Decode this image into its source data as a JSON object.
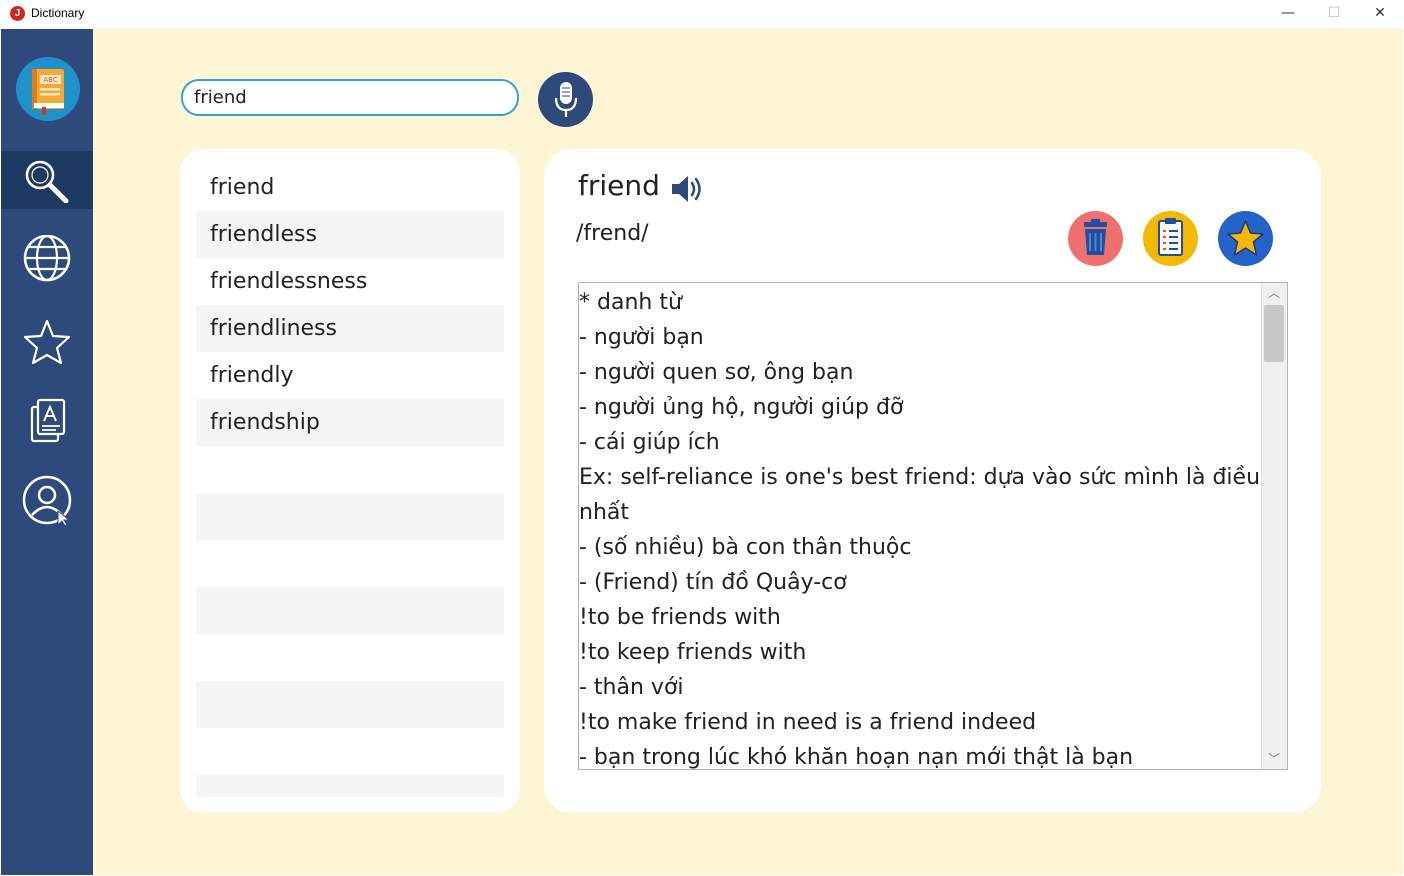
{
  "window": {
    "title": "Dictionary",
    "icon_letter": "J",
    "minimize_glyph": "—",
    "maximize_glyph": "☐",
    "close_glyph": "✕"
  },
  "sidebar": {
    "items": [
      {
        "icon": "search-icon",
        "active": true
      },
      {
        "icon": "globe-icon",
        "active": false
      },
      {
        "icon": "star-icon",
        "active": false
      },
      {
        "icon": "document-edit-icon",
        "active": false
      },
      {
        "icon": "user-account-icon",
        "active": false
      }
    ]
  },
  "search": {
    "value": "friend",
    "placeholder": ""
  },
  "word_list": {
    "items": [
      "friend",
      "friendless",
      "friendlessness",
      "friendliness",
      "friendly",
      "friendship"
    ]
  },
  "detail": {
    "word": "friend",
    "phonetic": "/frend/",
    "definition_lines": [
      "*  danh từ",
      "- người bạn",
      "- người quen sơ, ông bạn",
      "- người ủng hộ, người giúp đỡ",
      "- cái giúp ích",
      "Ex: self-reliance is one's best friend: dựa vào sức mình là điều tốt",
      "nhất",
      "- (số nhiều) bà con thân thuộc",
      "- (Friend) tín đồ Quây-cơ",
      "!to be friends with",
      "!to keep friends with",
      "- thân với",
      "!to make friend in need is a friend indeed",
      "- bạn trong lúc khó khăn hoạn nạn mới thật là bạn"
    ]
  },
  "colors": {
    "sidebar": "#2d4a7a",
    "sidebar_active": "#1e3a63",
    "background": "#fdf5d3",
    "search_border": "#2fa4d6",
    "delete_button": "#f07070",
    "notes_button": "#f5b800",
    "favorite_button": "#2563c9"
  }
}
